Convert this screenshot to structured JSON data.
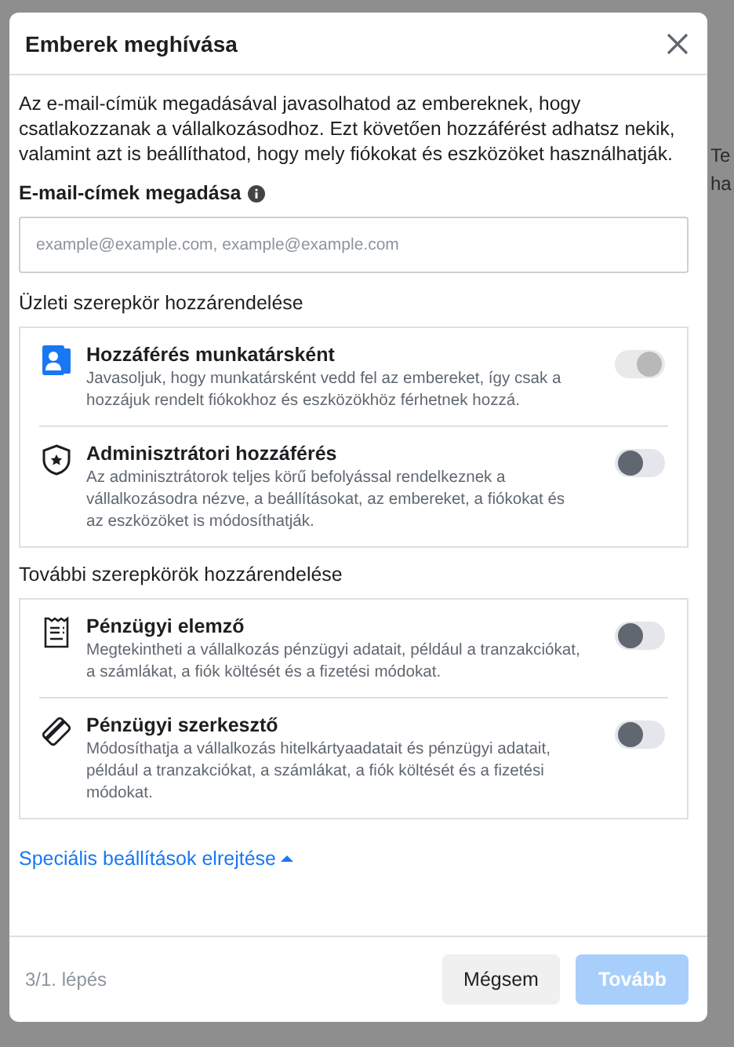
{
  "background": {
    "fragments": [
      "Te",
      "ha"
    ]
  },
  "dialog": {
    "title": "Emberek meghívása",
    "intro": "Az e-mail-címük megadásával javasolhatod az embereknek, hogy csatlakozzanak a vállalkozásodhoz. Ezt követően hozzáférést adhatsz nekik, valamint azt is beállíthatod, hogy mely fiókokat és eszközöket használhatják.",
    "email_label": "E-mail-címek megadása",
    "email_field": {
      "placeholder": "example@example.com, example@example.com"
    },
    "sections": [
      {
        "heading": "Üzleti szerepkör hozzárendelése",
        "roles": [
          {
            "kind": "person-card",
            "title": "Hozzáférés munkatársként",
            "description": "Javasoljuk, hogy munkatársként vedd fel az embereket, így csak a hozzájuk rendelt fiókokhoz és eszközökhöz férhetnek hozzá.",
            "on": true,
            "disabled": true
          },
          {
            "kind": "shield",
            "title": "Adminisztrátori hozzáférés",
            "description": "Az adminisztrátorok teljes körű befolyással rendelkeznek a vállalkozásodra nézve, a beállításokat, az embereket, a fiókokat és az eszközöket is módosíthatják.",
            "on": false,
            "disabled": false
          }
        ]
      },
      {
        "heading": "További szerepkörök hozzárendelése",
        "roles": [
          {
            "kind": "receipt",
            "title": "Pénzügyi elemző",
            "description": "Megtekintheti a vállalkozás pénzügyi adatait, például a tranzakciókat, a számlákat, a fiók költését és a fizetési módokat.",
            "on": false,
            "disabled": false
          },
          {
            "kind": "card",
            "title": "Pénzügyi szerkesztő",
            "description": "Módosíthatja a vállalkozás hitelkártyaadatait és pénzügyi adatait, például a tranzakciókat, a számlákat, a fiók költését és a fizetési módokat.",
            "on": false,
            "disabled": false
          }
        ]
      }
    ],
    "advanced_link": "Speciális beállítások elrejtése",
    "step": "3/1. lépés",
    "buttons": [
      {
        "label": "Mégsem",
        "kind": "secondary",
        "disabled": false
      },
      {
        "label": "Tovább",
        "kind": "primary",
        "disabled": true
      }
    ]
  }
}
